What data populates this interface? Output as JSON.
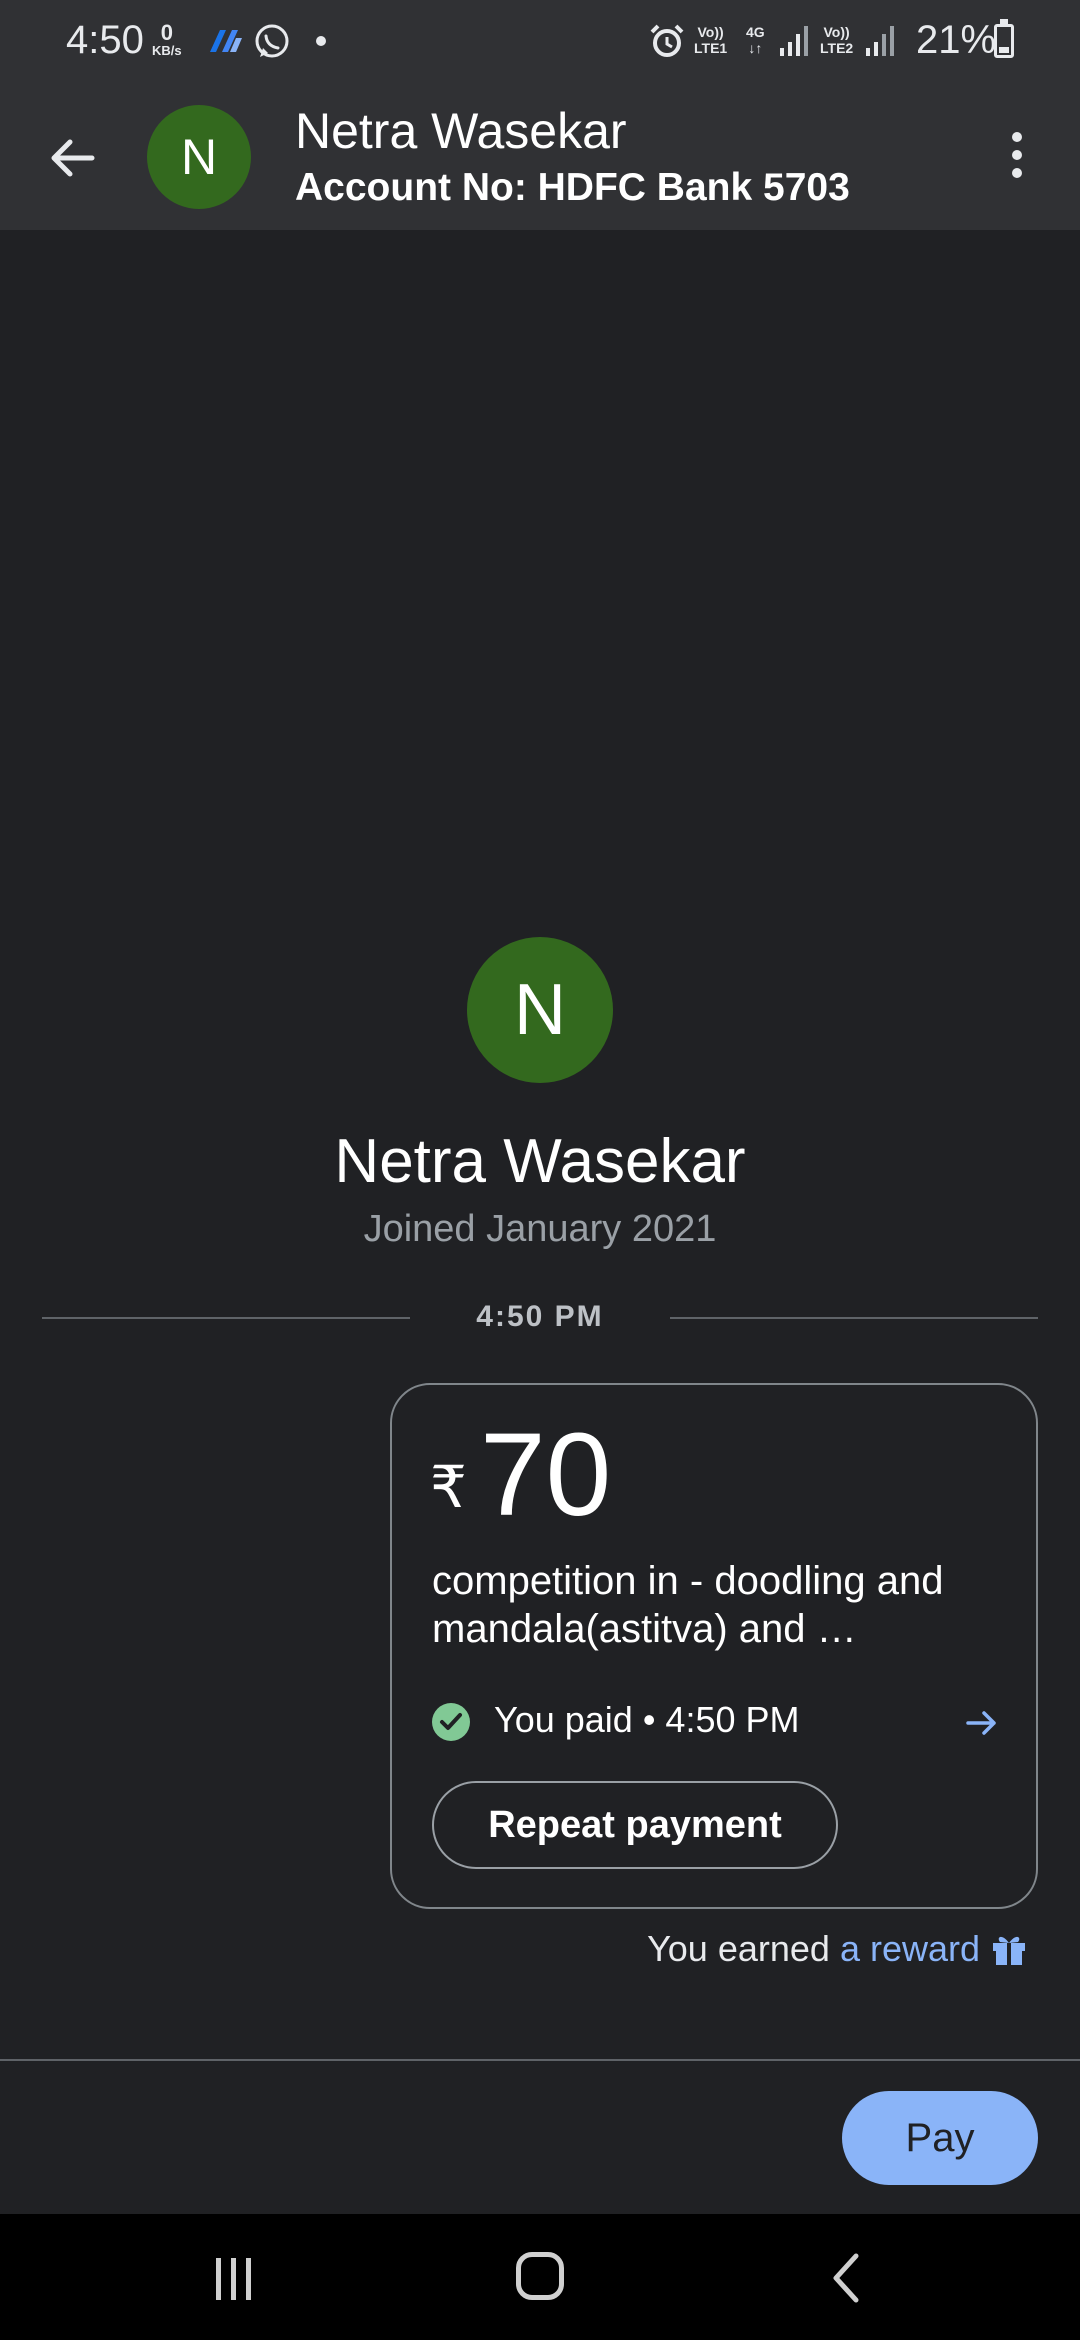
{
  "status_bar": {
    "time": "4:50",
    "net_speed_value": "0",
    "net_speed_unit": "KB/s",
    "sim1_label_top": "Vo))",
    "sim1_label_bottom": "LTE1",
    "sim1_net_top": "4G",
    "sim1_net_bottom": "↓↑",
    "sim2_label_top": "Vo))",
    "sim2_label_bottom": "LTE2",
    "battery": "21%",
    "icons": [
      "pay-app-icon",
      "whatsapp-icon",
      "dot-icon",
      "alarm-icon",
      "signal-icon",
      "battery-icon"
    ]
  },
  "header": {
    "avatar_initial": "N",
    "name": "Netra Wasekar",
    "account": "Account No: HDFC Bank 5703"
  },
  "contact": {
    "avatar_initial": "N",
    "name": "Netra Wasekar",
    "joined": "Joined January 2021"
  },
  "timeline": {
    "time": "4:50 PM"
  },
  "payment_card": {
    "currency": "₹",
    "amount": "70",
    "description": "competition in - doodling and mandala(astitva) and  …",
    "status": "You paid • 4:50 PM",
    "repeat_label": "Repeat payment"
  },
  "reward": {
    "prefix": "You earned ",
    "link": "a reward"
  },
  "actions": {
    "pay_label": "Pay"
  },
  "colors": {
    "background": "#202124",
    "bar": "#303134",
    "avatar": "#33691e",
    "accent": "#8ab4f8",
    "success": "#81c995"
  }
}
